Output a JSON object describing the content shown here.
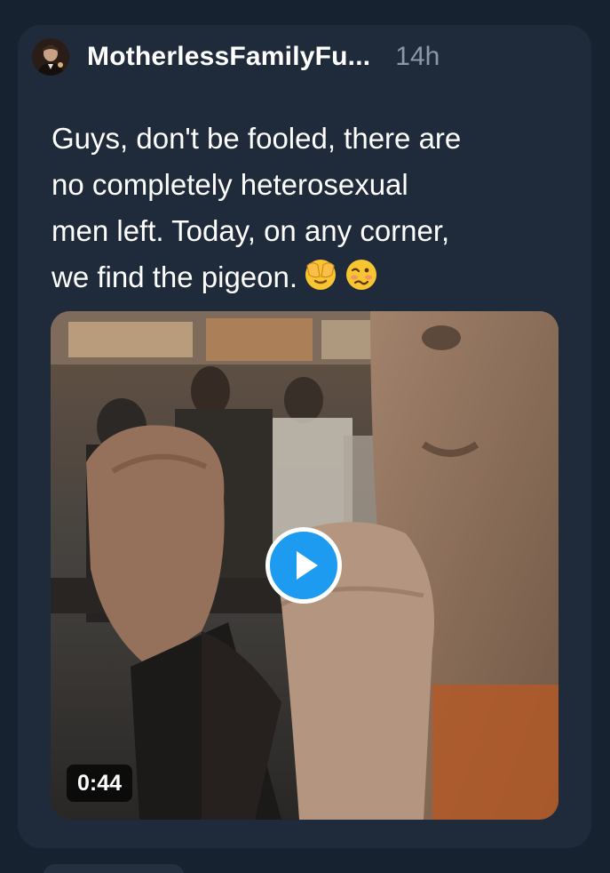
{
  "post": {
    "author": {
      "display_name": "MotherlessFamilyFu...",
      "avatar_icon": "avatar-photo"
    },
    "timestamp": "14h",
    "text_lines": [
      "Guys, don't be fooled, there are",
      "no completely heterosexual",
      "men left. Today, on any corner,",
      "we find the pigeon."
    ],
    "emojis": [
      "face-with-hand-over-eyes-icon",
      "woozy-face-icon"
    ],
    "video": {
      "duration": "0:44",
      "play_icon": "play-icon"
    }
  },
  "colors": {
    "background": "#172230",
    "card": "#1f2b3a",
    "text_primary": "#ffffff",
    "text_secondary": "#8c98a6",
    "accent": "#1d9bf0"
  }
}
